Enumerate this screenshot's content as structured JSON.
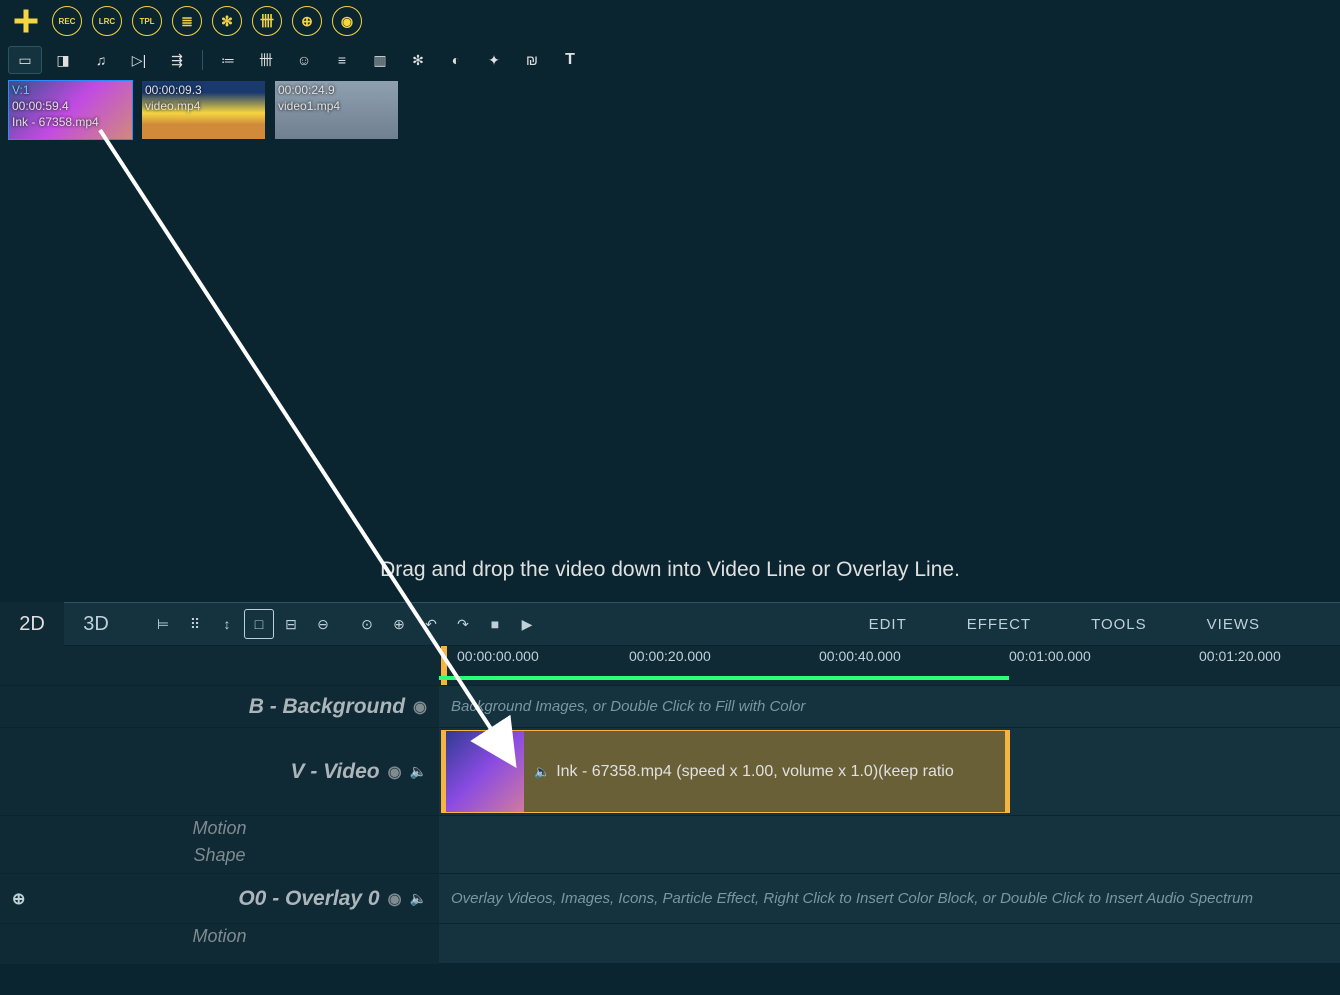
{
  "topbar": {
    "rec": "REC",
    "lrc": "LRC",
    "tpl": "TPL"
  },
  "bin": {
    "items": [
      {
        "idx": "V:1",
        "dur": "00:00:59.4",
        "name": "Ink - 67358.mp4"
      },
      {
        "idx": "",
        "dur": "00:00:09.3",
        "name": "video.mp4"
      },
      {
        "idx": "",
        "dur": "00:00:24.9",
        "name": "video1.mp4"
      }
    ],
    "hint": "Drag and drop the video down into Video Line or Overlay Line."
  },
  "timeline": {
    "tabs": {
      "d2": "2D",
      "d3": "3D"
    },
    "menus": {
      "edit": "EDIT",
      "effect": "EFFECT",
      "tools": "TOOLS",
      "views": "VIEWS"
    },
    "ruler": [
      "00:00:00.000",
      "00:00:20.000",
      "00:00:40.000",
      "00:01:00.000",
      "00:01:20.000"
    ]
  },
  "tracks": {
    "bg": {
      "label": "B - Background",
      "hint": "Background Images, or Double Click to Fill with Color"
    },
    "video": {
      "label": "V - Video"
    },
    "video_sub1": "Motion",
    "video_sub2": "Shape",
    "overlay": {
      "label": "O0 - Overlay 0",
      "hint": "Overlay Videos, Images, Icons, Particle Effect, Right Click to Insert Color Block, or Double Click to Insert Audio Spectrum"
    },
    "ov_sub1": "Motion"
  },
  "clip": {
    "text": "Ink - 67358.mp4  (speed x 1.00, volume x 1.0)(keep ratio"
  }
}
